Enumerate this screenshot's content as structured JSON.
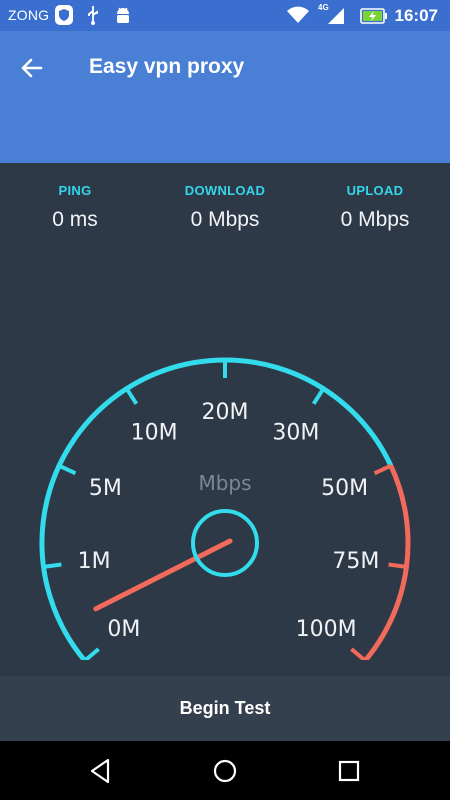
{
  "status_bar": {
    "carrier": "ZONG",
    "network_type": "4G",
    "time": "16:07",
    "icons": [
      "shield-icon",
      "usb-icon",
      "android-icon",
      "wifi-icon",
      "signal-icon",
      "battery-charging-icon"
    ]
  },
  "app_bar": {
    "title": "Easy vpn proxy",
    "back_icon": "arrow-left-icon"
  },
  "stats": {
    "ping": {
      "label": "PING",
      "value": "0 ms"
    },
    "download": {
      "label": "DOWNLOAD",
      "value": "0 Mbps"
    },
    "upload": {
      "label": "UPLOAD",
      "value": "0 Mbps"
    }
  },
  "gauge": {
    "unit": "Mbps",
    "tick_labels": [
      "0M",
      "1M",
      "5M",
      "10M",
      "20M",
      "30M",
      "50M",
      "75M",
      "100M"
    ],
    "current_value": 0,
    "colors": {
      "normal": "#33dcec",
      "high": "#f26a5b",
      "needle": "#f26a5b"
    }
  },
  "begin_test": {
    "label": "Begin Test"
  },
  "nav_bar": {
    "icons": [
      "back-triangle-icon",
      "home-circle-icon",
      "recents-square-icon"
    ]
  },
  "colors": {
    "status_bar": "#3a6fd0",
    "app_bar": "#4a7fd6",
    "background": "#2e3947",
    "accent": "#33d6ea"
  }
}
